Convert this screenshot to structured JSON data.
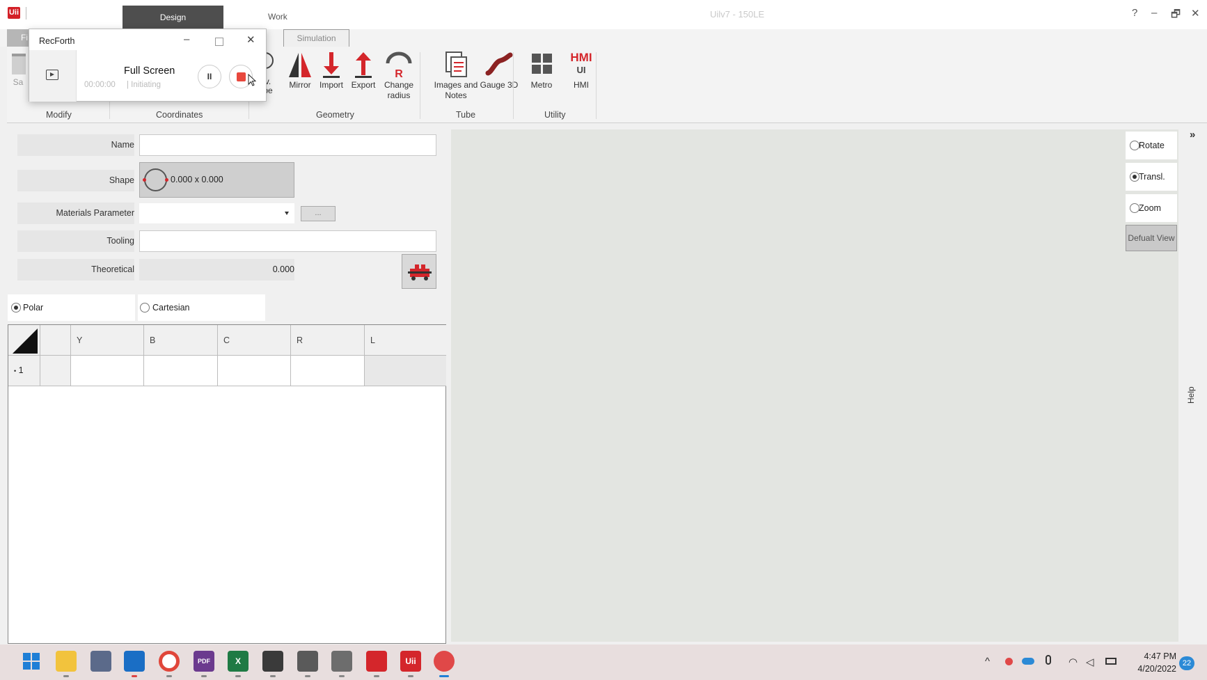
{
  "app": {
    "logo_text": "Uii",
    "window_title": "Uilv7 - 150LE",
    "help_symbol": "?",
    "minimize_symbol": "–",
    "restore_symbol": "🗗",
    "close_symbol": "✕"
  },
  "top_tabs": [
    {
      "label": "Design",
      "active": true
    },
    {
      "label": "Work",
      "active": false
    }
  ],
  "ribbon": {
    "file_tab_label": "Fi",
    "simulation_tab_label": "Simulation",
    "partial_save_label": "Sa",
    "partial_tube_label": "v.\nbe",
    "buttons": [
      {
        "name": "mirror",
        "label": "Mirror",
        "icon": "mirror-icon"
      },
      {
        "name": "import",
        "label": "Import",
        "icon": "import-arrow-icon"
      },
      {
        "name": "export",
        "label": "Export",
        "icon": "export-arrow-icon"
      },
      {
        "name": "change-radius",
        "label": "Change radius",
        "icon": "change-radius-icon"
      },
      {
        "name": "images-and-notes",
        "label": "Images and Notes",
        "icon": "notes-icon"
      },
      {
        "name": "gauge-3d",
        "label": "Gauge 3D",
        "icon": "gauge-icon"
      },
      {
        "name": "metro",
        "label": "Metro",
        "icon": "grid-icon"
      },
      {
        "name": "hmi",
        "label": "HMI",
        "icon": "hmi-icon"
      }
    ],
    "groups": [
      "Modify",
      "Coordinates",
      "Geometry",
      "Tube",
      "Utility"
    ],
    "hmi_icon_text": "HMI",
    "hmi_icon_sub": "UI"
  },
  "recforth": {
    "title": "RecForth",
    "mode": "Full Screen",
    "time": "00:00:00",
    "status": "| Initiating",
    "pause_symbol": "II"
  },
  "form": {
    "name_label": "Name",
    "name_value": "",
    "shape_label": "Shape",
    "shape_value": "0.000 x 0.000",
    "materials_label": "Materials Parameter",
    "materials_value": "",
    "ellipsis_label": "...",
    "tooling_label": "Tooling",
    "tooling_value": "",
    "theoretical_label": "Theoretical",
    "theoretical_value": "0.000"
  },
  "coords": {
    "polar_label": "Polar",
    "cartesian_label": "Cartesian",
    "selected": "Polar"
  },
  "grid": {
    "columns": [
      "Y",
      "B",
      "C",
      "R",
      "L"
    ],
    "rows": [
      {
        "index": "1",
        "Y": "",
        "B": "",
        "C": "",
        "R": "",
        "L": ""
      }
    ],
    "row_marker": "•"
  },
  "view_controls": {
    "rotate": "Rotate",
    "transl": "Transl.",
    "zoom": "Zoom",
    "selected": "Transl.",
    "default_view": "Defualt View",
    "expand_symbol": "»",
    "help_label": "Help"
  },
  "taskbar": {
    "apps": [
      "start",
      "file-explorer",
      "calculator",
      "outlook",
      "chrome",
      "pdf",
      "excel",
      "pen-app",
      "diagram-app",
      "cad-app",
      "robot-app",
      "uii",
      "recforth"
    ],
    "icons_text": {
      "pdf": "PDF",
      "excel": "X",
      "uii": "Uii"
    },
    "time": "4:47 PM",
    "date": "4/20/2022",
    "notification_count": "22"
  }
}
